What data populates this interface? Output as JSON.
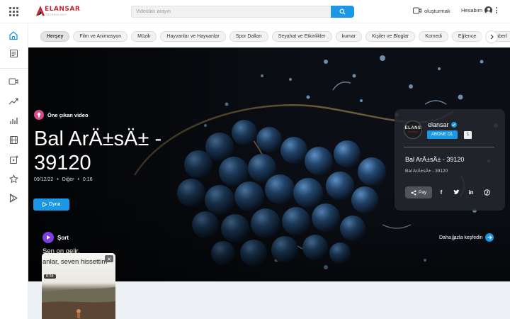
{
  "header": {
    "logo_text": "ELANSAR",
    "logo_tagline": "TECHNOLOGY",
    "search_placeholder": "Videoları arayın",
    "create_label": "oluşturmak",
    "account_label": "Hesabım"
  },
  "sidebar": {
    "items": [
      {
        "icon": "home-icon",
        "active": true
      },
      {
        "icon": "subscriptions-icon"
      },
      {
        "icon": "video-icon"
      },
      {
        "icon": "trending-icon"
      },
      {
        "icon": "charts-icon"
      },
      {
        "icon": "film-icon"
      },
      {
        "icon": "add-video-icon"
      },
      {
        "icon": "star-icon"
      },
      {
        "icon": "play-store-icon"
      }
    ]
  },
  "chips": [
    "Herşey",
    "Film ve Animasyon",
    "Müzik",
    "Hayvanlar ve Hayvanlar",
    "Spor Dalları",
    "Seyahat ve Etkinlikler",
    "kumar",
    "Kişiler ve Bloglar",
    "Komedi",
    "Eğlence",
    "Haberl"
  ],
  "hero": {
    "featured_label": "Öne çıkan video",
    "title": "Bal ArÄ±sÄ± - 39120",
    "date": "09/12/22",
    "separator": "•",
    "category": "Diğer",
    "duration": "0:16",
    "play_label": "Oyna"
  },
  "channel_card": {
    "avatar_text": "ELANS",
    "avatar_subtext": "TECHNO",
    "name": "elansar",
    "subscribe_label": "ABONE OL",
    "subscriber_count": "1",
    "video_title": "Bal ArÄ±sÄ± - 39120",
    "video_subtitle": "Bal ArÄ±sÄ± - 39120",
    "share_label": "Pay",
    "social": [
      {
        "icon": "facebook-icon",
        "glyph": "f"
      },
      {
        "icon": "twitter-icon",
        "glyph": ""
      },
      {
        "icon": "linkedin-icon",
        "glyph": "in"
      },
      {
        "icon": "pinterest-icon",
        "glyph": ""
      }
    ]
  },
  "shorts": {
    "label": "Şort",
    "discover_label": "Daha fazla keşfedin",
    "card": {
      "line1": "Sen on gelir,",
      "line2": "anlar, seven hissettim",
      "duration": "0:54"
    }
  },
  "colors": {
    "accent": "#1a97e5",
    "brand": "#c0262d",
    "featured_badge": "#d94a8c",
    "shorts_badge": "#7b3fe4"
  }
}
